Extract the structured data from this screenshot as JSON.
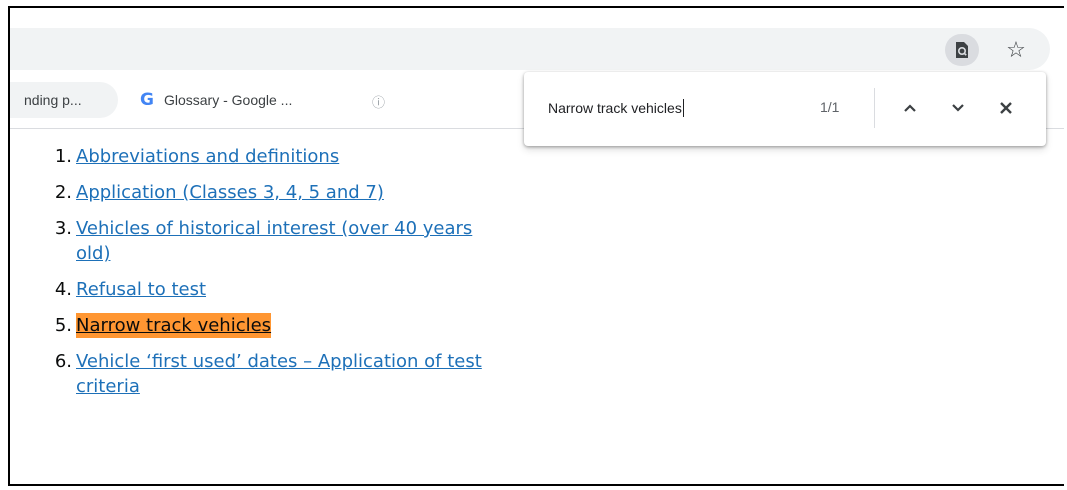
{
  "toolbar": {
    "lens_icon": "google-lens-icon",
    "star_icon": "star-bookmark-icon"
  },
  "bookmarks": {
    "items": [
      {
        "label": "nding p..."
      },
      {
        "label": "Glossary - Google ...",
        "icon": "google-g-icon",
        "icon_text": "G"
      },
      {
        "icon": "info-icon",
        "icon_text": "ⓘ"
      }
    ]
  },
  "find_bar": {
    "query": "Narrow track vehicles",
    "count": "1/1",
    "prev_icon": "chevron-up-icon",
    "next_icon": "chevron-down-icon",
    "close_icon": "close-icon"
  },
  "content": {
    "items": [
      {
        "number": "1.",
        "text": "Abbreviations and definitions"
      },
      {
        "number": "2.",
        "text": "Application (Classes 3, 4, 5 and 7)"
      },
      {
        "number": "3.",
        "text": "Vehicles of historical interest (over 40 years old)"
      },
      {
        "number": "4.",
        "text": "Refusal to test"
      },
      {
        "number": "5.",
        "text": "Narrow track vehicles",
        "highlighted": true
      },
      {
        "number": "6.",
        "text": "Vehicle ‘first used’ dates – Application of test criteria"
      }
    ]
  },
  "colors": {
    "link": "#1d70b8",
    "find_highlight": "#ff9632",
    "toolbar_bg": "#f1f3f4"
  }
}
